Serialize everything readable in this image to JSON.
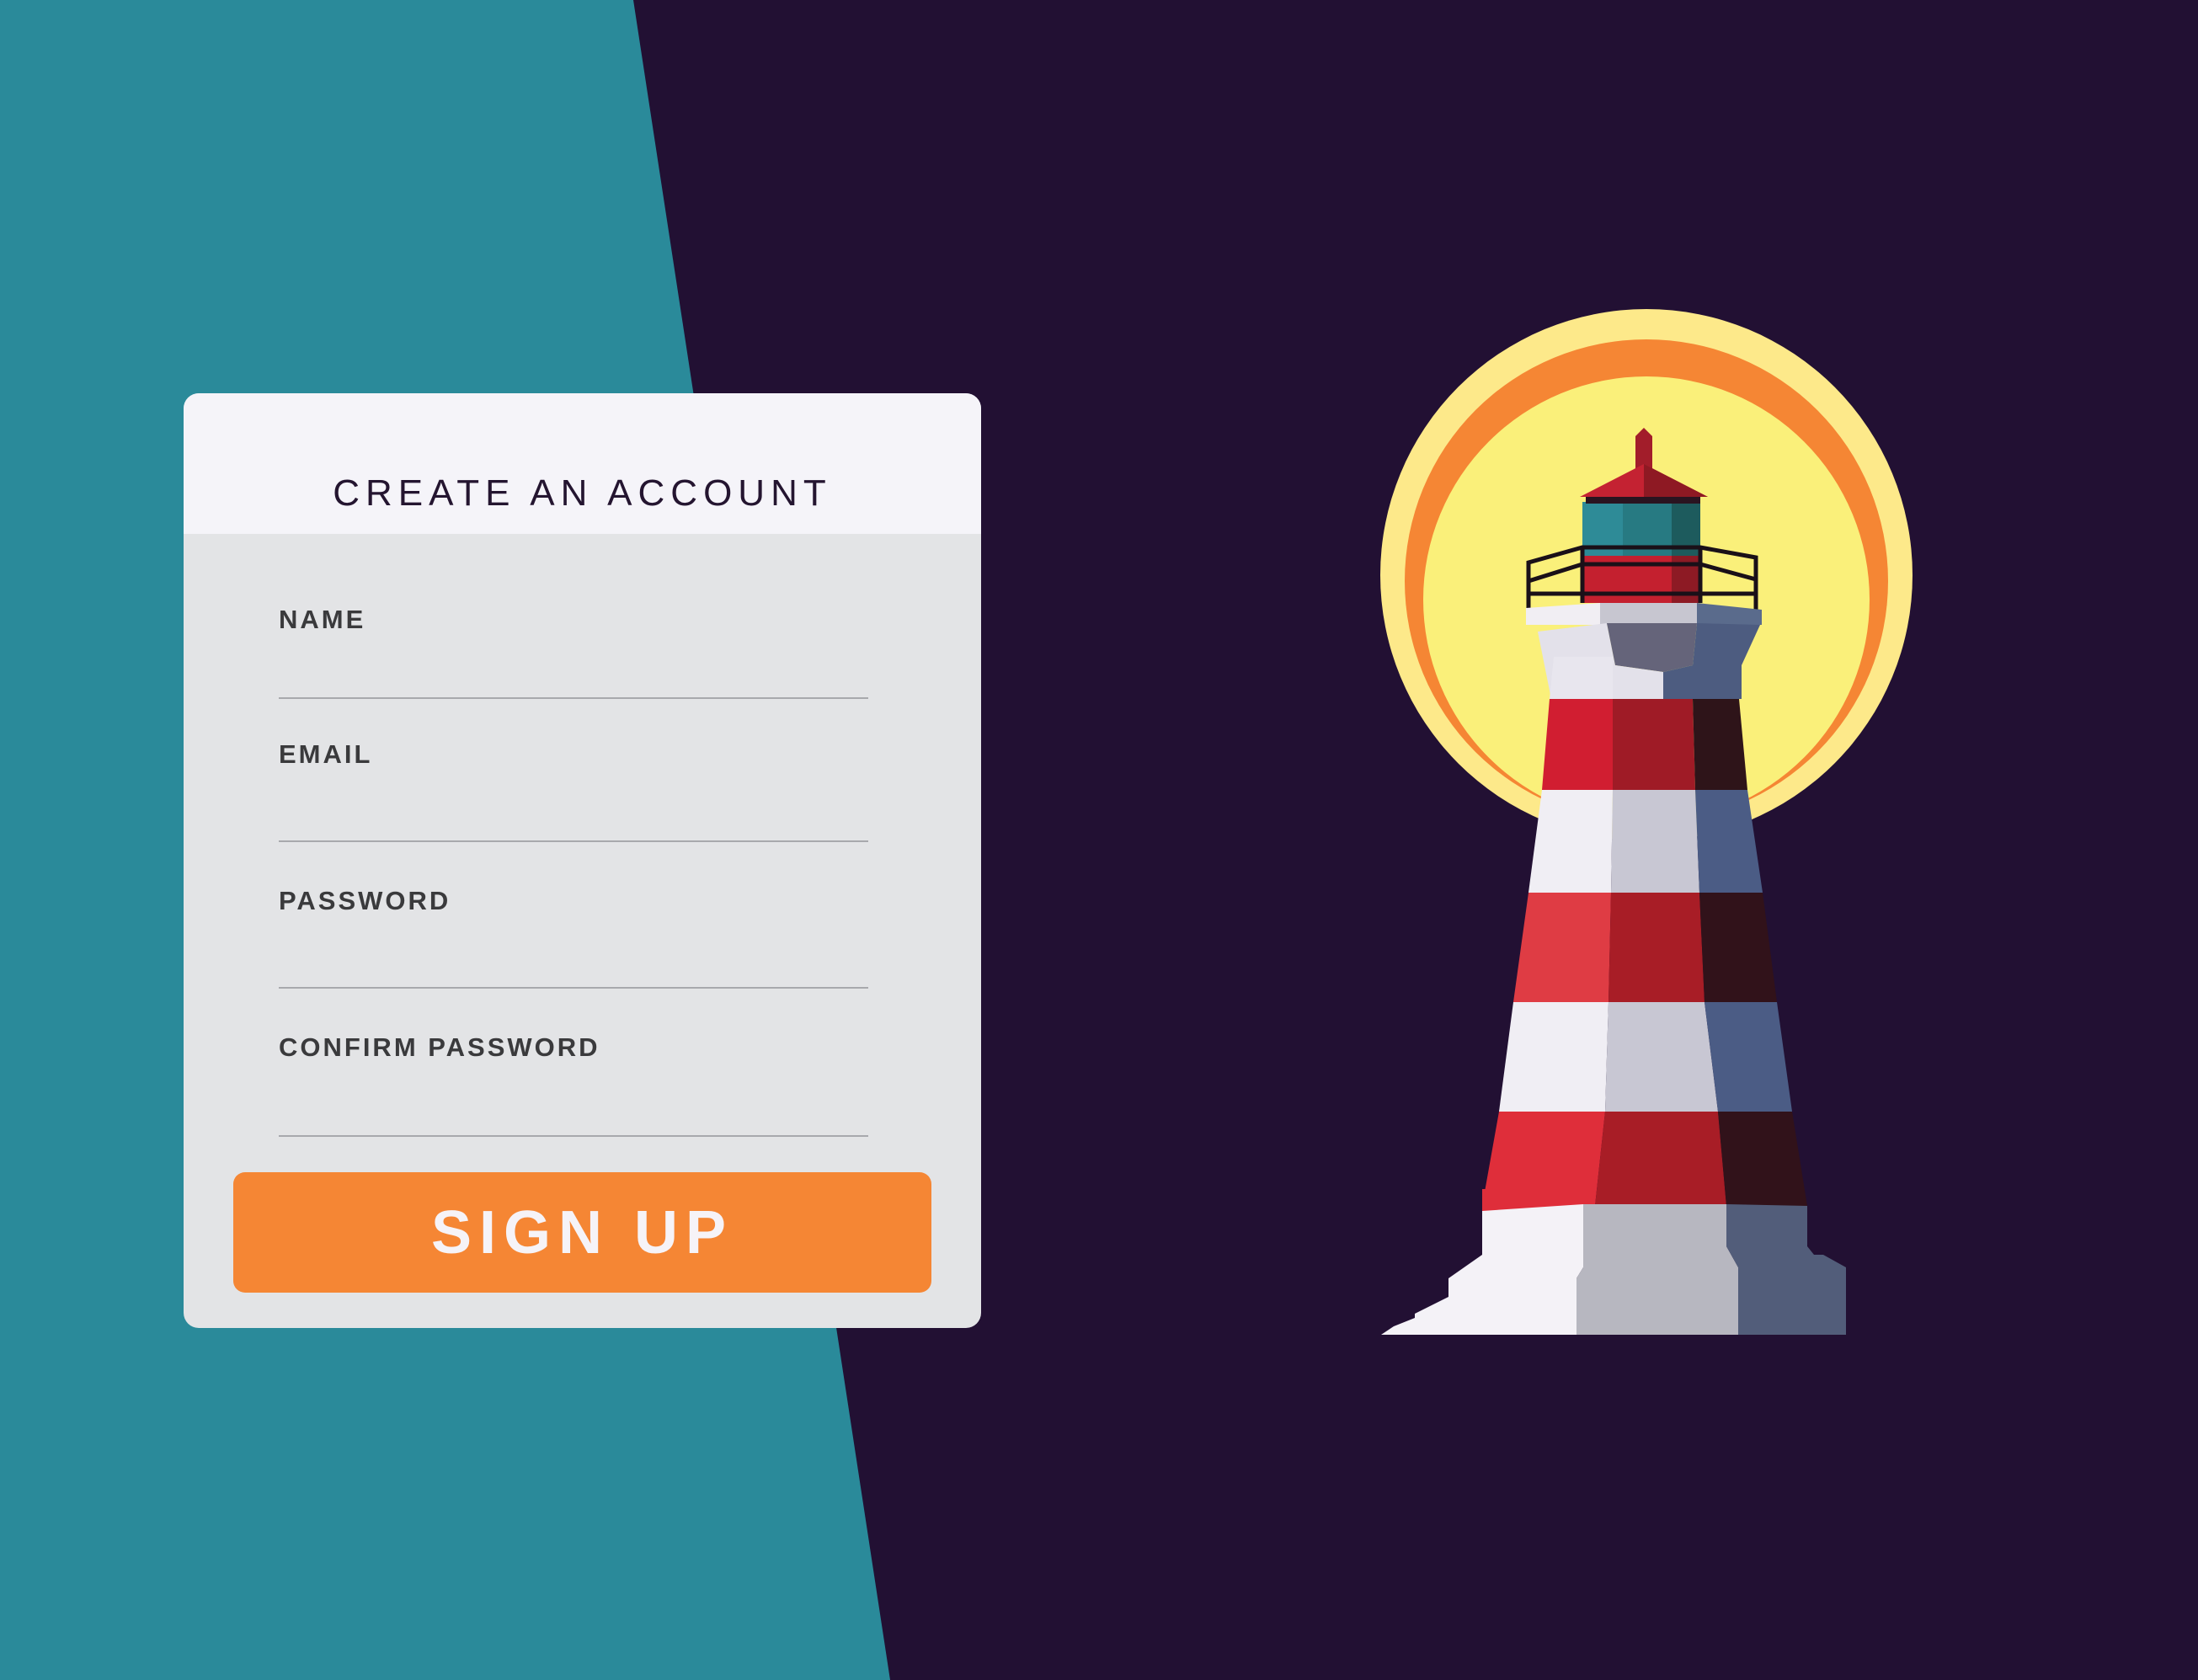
{
  "form": {
    "title": "CREATE AN ACCOUNT",
    "fields": [
      {
        "label": "NAME",
        "value": ""
      },
      {
        "label": "EMAIL",
        "value": ""
      },
      {
        "label": "PASSWORD",
        "value": ""
      },
      {
        "label": "CONFIRM PASSWORD",
        "value": ""
      }
    ],
    "submit_label": "SIGN UP"
  },
  "colors": {
    "background_dark": "#221033",
    "background_teal": "#2a8a9a",
    "card": "#e3e4e6",
    "card_header": "#f5f4f9",
    "accent": "#f58634",
    "sun_outer": "#fde98a",
    "sun_ring": "#f58634",
    "sun_inner": "#faf07a",
    "stripe_red": "#d52634",
    "stripe_white": "#f2eff5"
  },
  "illustration": {
    "subject": "lighthouse-illustration",
    "backdrop": "sun-icon"
  }
}
